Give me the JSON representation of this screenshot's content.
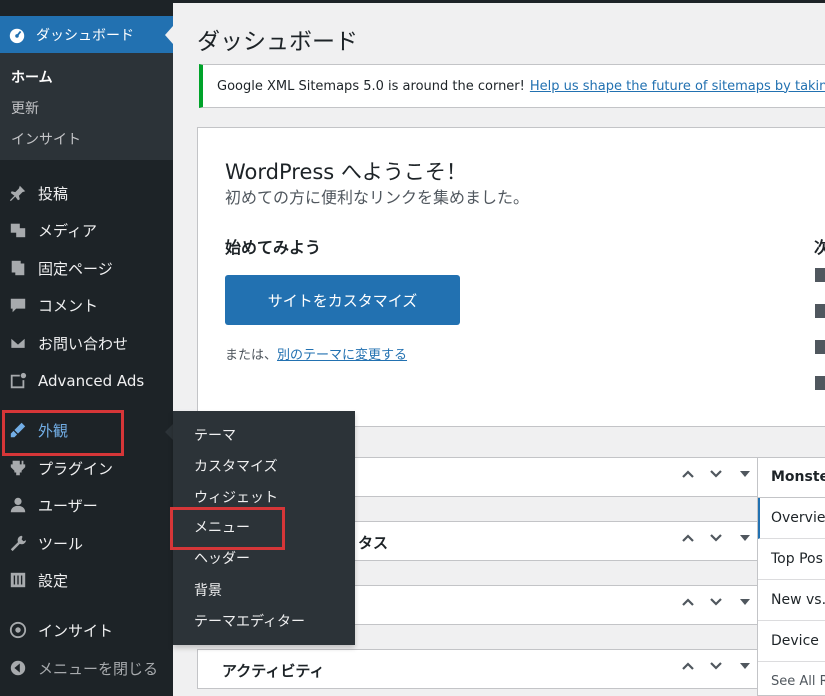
{
  "sidebar": {
    "dashboard_label": "ダッシュボード",
    "submenu": [
      "ホーム",
      "更新",
      "インサイト"
    ],
    "items": [
      {
        "label": "投稿",
        "icon": "pin-icon"
      },
      {
        "label": "メディア",
        "icon": "media-icon"
      },
      {
        "label": "固定ページ",
        "icon": "pages-icon"
      },
      {
        "label": "コメント",
        "icon": "comment-icon"
      },
      {
        "label": "お問い合わせ",
        "icon": "mail-icon"
      },
      {
        "label": "Advanced Ads",
        "icon": "ads-icon"
      },
      {
        "label": "外観",
        "icon": "brush-icon"
      },
      {
        "label": "プラグイン",
        "icon": "plugin-icon"
      },
      {
        "label": "ユーザー",
        "icon": "user-icon"
      },
      {
        "label": "ツール",
        "icon": "wrench-icon"
      },
      {
        "label": "設定",
        "icon": "settings-icon"
      },
      {
        "label": "インサイト",
        "icon": "insights-icon"
      },
      {
        "label": "メニューを閉じる",
        "icon": "collapse-icon"
      }
    ]
  },
  "flyout": {
    "items": [
      "テーマ",
      "カスタマイズ",
      "ウィジェット",
      "メニュー",
      "ヘッダー",
      "背景",
      "テーマエディター"
    ]
  },
  "main": {
    "title": "ダッシュボード",
    "notice": {
      "text": "Google XML Sitemaps 5.0 is around the corner!",
      "link": "Help us shape the future of sitemaps by taking"
    },
    "welcome": {
      "title": "WordPress へようこそ！",
      "subtitle": "初めての方に便利なリンクを集めました。",
      "start_heading": "始めてみよう",
      "next_heading": "次",
      "customize_button": "サイトをカスタマイズ",
      "or_text": "または、",
      "change_theme_link": "別のテーマに変更する"
    },
    "postboxes": [
      "",
      "タス",
      "",
      "アクティビティ"
    ],
    "monster": {
      "title": "Monste",
      "rows": [
        "Overvie",
        "Top Pos",
        "New vs.",
        "Device",
        "See All R"
      ]
    }
  },
  "colors": {
    "sidebar_bg": "#1d2327",
    "accent": "#2271b1",
    "highlight_box": "#d63638",
    "notice_border": "#00a32a"
  }
}
